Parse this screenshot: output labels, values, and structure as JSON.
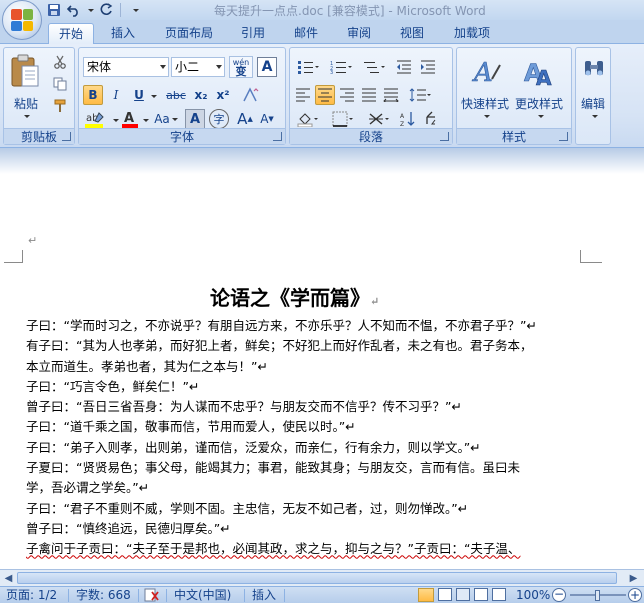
{
  "window": {
    "title": "每天提升一点点.doc [兼容模式] - Microsoft Word"
  },
  "quick_access": {
    "icons": [
      "save-icon",
      "undo-icon",
      "redo-icon",
      "customize-icon"
    ]
  },
  "tabs": [
    {
      "label": "开始",
      "active": true
    },
    {
      "label": "插入",
      "active": false
    },
    {
      "label": "页面布局",
      "active": false
    },
    {
      "label": "引用",
      "active": false
    },
    {
      "label": "邮件",
      "active": false
    },
    {
      "label": "审阅",
      "active": false
    },
    {
      "label": "视图",
      "active": false
    },
    {
      "label": "加载项",
      "active": false
    }
  ],
  "ribbon": {
    "clipboard": {
      "group_label": "剪贴板",
      "paste_label": "粘贴"
    },
    "font": {
      "group_label": "字体",
      "font_name": "宋体",
      "font_size": "小二",
      "wen_label": "wén",
      "wen_char": "变",
      "a_label": "A",
      "bold": "B",
      "italic": "I",
      "underline": "U",
      "strike": "abc",
      "subscript": "x₂",
      "superscript": "x²",
      "aa_label": "Aa",
      "char_label": "字",
      "grow_label": "A",
      "shrink_label": "A"
    },
    "paragraph": {
      "group_label": "段落"
    },
    "styles": {
      "group_label": "样式",
      "quick_styles": "快速样式",
      "change_styles": "更改样式"
    },
    "editing": {
      "edit_label": "编辑"
    }
  },
  "colors": {
    "highlight": "#ffff00",
    "font_color": "#ff0000",
    "ribbon_text": "#15428b"
  },
  "document": {
    "title": "论语之《学而篇》",
    "paragraph_mark": "↵",
    "lines": [
      "子曰：“学而时习之，不亦说乎？有朋自远方来，不亦乐乎？人不知而不愠，不亦君子乎？”↵",
      "有子曰：“其为人也孝弟，而好犯上者，鲜矣；不好犯上而好作乱者，未之有也。君子务本，",
      "本立而道生。孝弟也者，其为仁之本与！”↵",
      "子曰：“巧言令色，鲜矣仁！”↵",
      "曾子曰：“吾日三省吾身：为人谋而不忠乎？与朋友交而不信乎？传不习乎？”↵",
      "子曰：“道千乘之国，敬事而信，节用而爱人，使民以时。”↵",
      "子曰：“弟子入则孝，出则弟，谨而信，泛爱众，而亲仁，行有余力，则以学文。”↵",
      "子夏曰：“贤贤易色；事父母，能竭其力；事君，能致其身；与朋友交，言而有信。虽曰未",
      "学，吾必谓之学矣。”↵",
      "子曰：“君子不重则不威，学则不固。主忠信，无友不如己者，过，则勿惮改。”↵",
      "曾子曰：“慎终追远，民德归厚矣。”↵",
      "子禽问于子贡曰：“夫子至于是邦也，必闻其政，求之与，抑与之与？”子贡曰：“夫子温、"
    ]
  },
  "statusbar": {
    "page": "页面: 1/2",
    "words": "字数: 668",
    "language": "中文(中国)",
    "mode": "插入",
    "zoom": "100%"
  }
}
